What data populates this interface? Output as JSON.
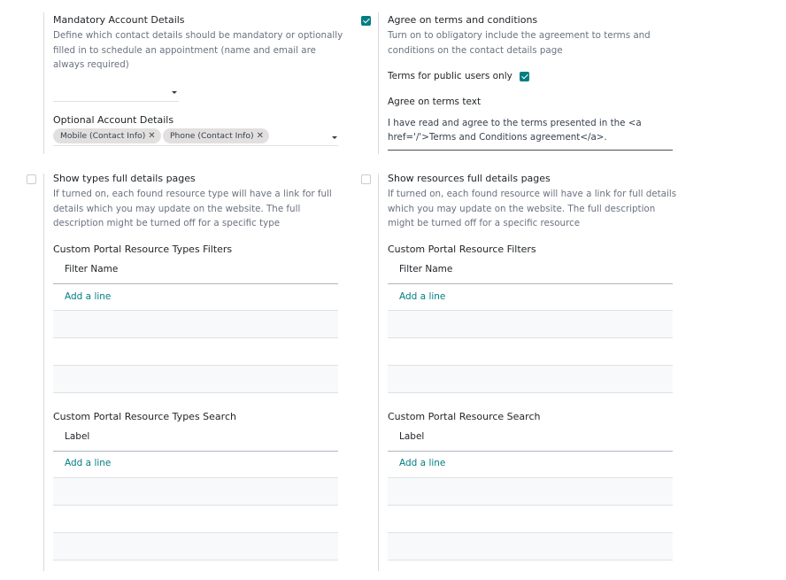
{
  "mandatory": {
    "title": "Mandatory Account Details",
    "description": "Define which contact details should be mandatory or optionally filled in to schedule an appointment (name and email are always required)",
    "value": ""
  },
  "optional": {
    "title": "Optional Account Details",
    "tags": [
      "Mobile (Contact Info)",
      "Phone (Contact Info)"
    ],
    "tag_remove": "✕"
  },
  "agree": {
    "title": "Agree on terms and conditions",
    "description": "Turn on to obligatory include the agreement to terms and conditions on the contact details page",
    "checked": true
  },
  "public_only": {
    "label": "Terms for public users only",
    "checked": true
  },
  "terms_text": {
    "label": "Agree on terms text",
    "value": "I have read and agree to the terms presented in the <a href='/'>Terms and Conditions agreement</a>."
  },
  "types_full": {
    "title": "Show types full details pages",
    "description": "If turned on, each found resource type will have a link for full details which you may update on the website. The full description might be turned off for a specific type",
    "checked": false
  },
  "resources_full": {
    "title": "Show resources full details pages",
    "description": "If turned on, each found resource will have a link for full details which you may update on the website. The full description might be turned off for a specific resource",
    "checked": false
  },
  "types_filters": {
    "title": "Custom Portal Resource Types Filters",
    "column": "Filter Name",
    "add_line": "Add a line"
  },
  "resource_filters": {
    "title": "Custom Portal Resource Filters",
    "column": "Filter Name",
    "add_line": "Add a line"
  },
  "types_search": {
    "title": "Custom Portal Resource Types Search",
    "column": "Label",
    "add_line": "Add a line"
  },
  "resource_search": {
    "title": "Custom Portal Resource Search",
    "column": "Label",
    "add_line": "Add a line"
  },
  "colors": {
    "accent": "#017e84",
    "tag_bg": "#e2dfdf"
  }
}
